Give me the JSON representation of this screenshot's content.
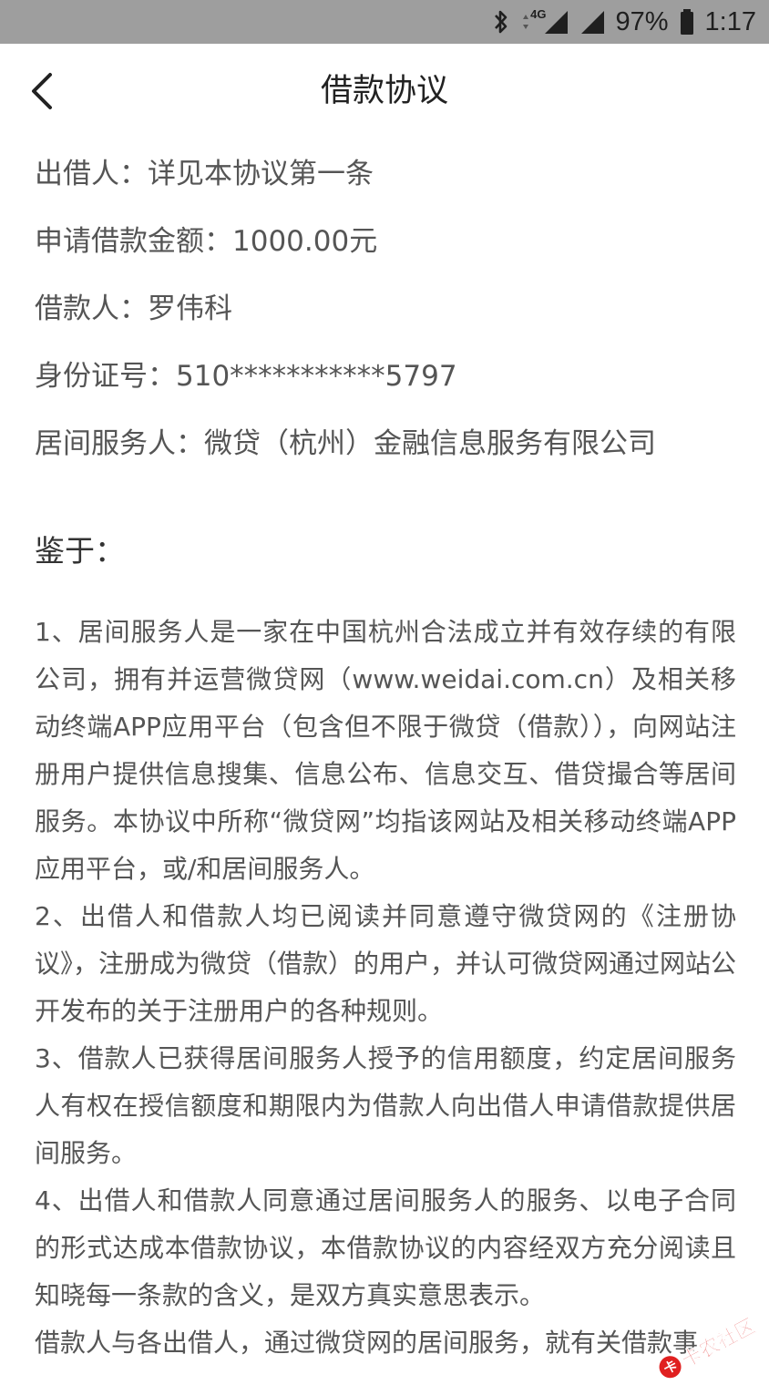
{
  "status_bar": {
    "network": "4G",
    "battery": "97%",
    "time": "1:17"
  },
  "header": {
    "title": "借款协议",
    "back_icon": "chevron-left-icon"
  },
  "parties": [
    "出借人：详见本协议第一条",
    "申请借款金额：1000.00元",
    "借款人：罗伟科",
    "身份证号：510***********5797",
    "居间服务人：微贷（杭州）金融信息服务有限公司"
  ],
  "section_heading": "鉴于：",
  "clauses": [
    "1、居间服务人是一家在中国杭州合法成立并有效存续的有限公司，拥有并运营微贷网（www.weidai.com.cn）及相关移动终端APP应用平台（包含但不限于微贷（借款）），向网站注册用户提供信息搜集、信息公布、信息交互、借贷撮合等居间服务。本协议中所称“微贷网”均指该网站及相关移动终端APP应用平台，或/和居间服务人。",
    "2、出借人和借款人均已阅读并同意遵守微贷网的《注册协议》，注册成为微贷（借款）的用户，并认可微贷网通过网站公开发布的关于注册用户的各种规则。",
    "3、借款人已获得居间服务人授予的信用额度，约定居间服务人有权在授信额度和期限内为借款人向出借人申请借款提供居间服务。",
    "4、出借人和借款人同意通过居间服务人的服务、以电子合同的形式达成本借款协议，本借款协议的内容经双方充分阅读且知晓每一条款的含义，是双方真实意思表示。",
    "借款人与各出借人，通过微贷网的居间服务，就有关借款事"
  ],
  "watermark": {
    "text": "卡农社区"
  },
  "colors": {
    "status_bar_bg": "#9e9e9e",
    "text_primary": "#222222",
    "text_body": "#555555",
    "watermark": "#e02020"
  }
}
